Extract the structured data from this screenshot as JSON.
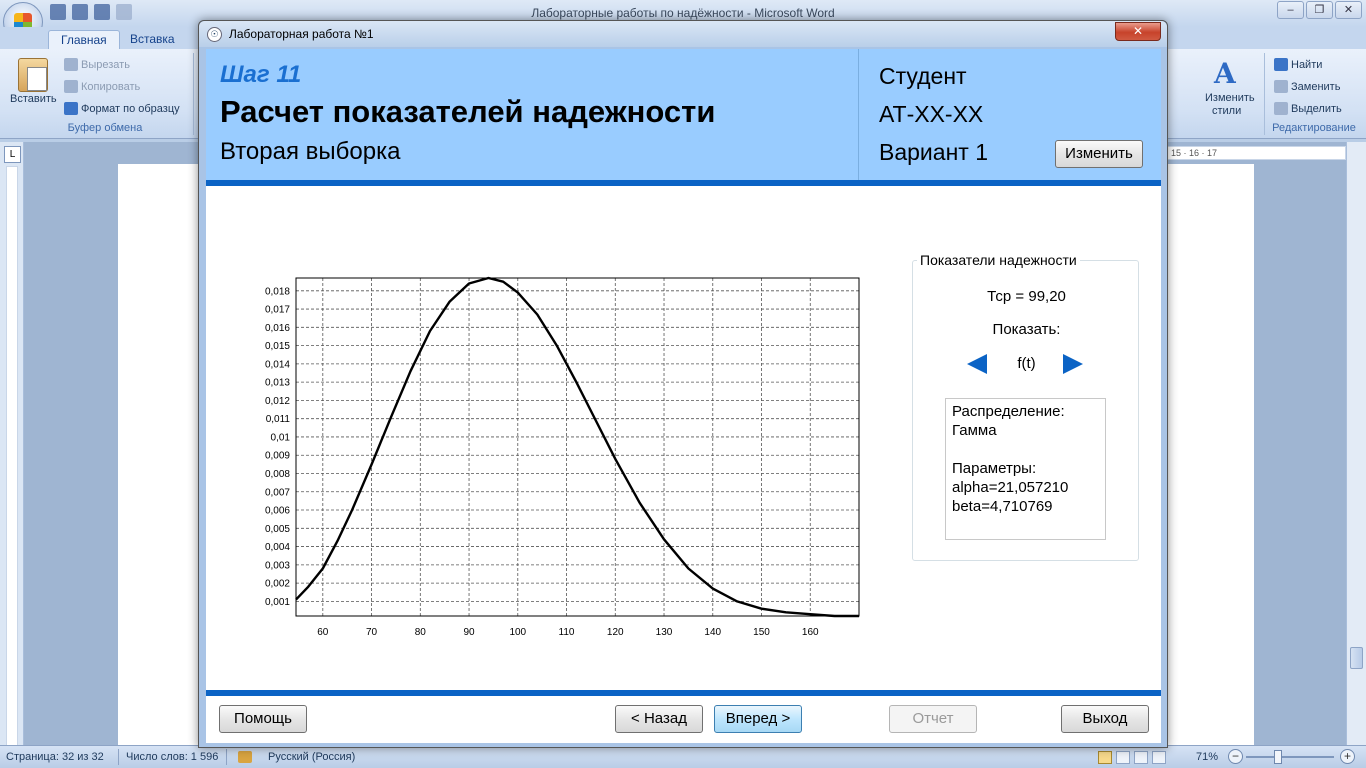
{
  "word": {
    "window_title": "Лабораторные работы по надёжности - Microsoft Word",
    "tabs": [
      "Главная",
      "Вставка"
    ],
    "ribbon": {
      "paste": "Вставить",
      "cut": "Вырезать",
      "copy": "Копировать",
      "format_painter": "Формат по образцу",
      "clipboard_group": "Буфер обмена",
      "change_styles_line1": "Изменить",
      "change_styles_line2": "стили",
      "find": "Найти",
      "replace": "Заменить",
      "select": "Выделить",
      "editing_group": "Редактирование"
    },
    "ruler_right": "15 · 16 · 17",
    "status": {
      "page": "Страница: 32 из 32",
      "words": "Число слов: 1 596",
      "language": "Русский (Россия)",
      "zoom": "71%"
    }
  },
  "dialog": {
    "title": "Лабораторная работа №1",
    "close": "✕",
    "step": "Шаг 11",
    "heading": "Расчет показателей надежности",
    "subheading": "Вторая выборка",
    "student": "Студент",
    "group": "АТ-ХХ-ХХ",
    "variant": "Вариант 1",
    "change_button": "Изменить",
    "panel": {
      "legend": "Показатели надежности",
      "tcp": "Тср = 99,20",
      "show_label": "Показать:",
      "function": "f(t)",
      "distribution_label": "Распределение:",
      "distribution": "Гамма",
      "params_label": "Параметры:",
      "alpha": "alpha=21,057210",
      "beta": "beta=4,710769"
    },
    "buttons": {
      "help": "Помощь",
      "back": "< Назад",
      "next": "Вперед >",
      "report": "Отчет",
      "exit": "Выход"
    }
  },
  "chart_data": {
    "type": "line",
    "title": "",
    "xlabel": "",
    "ylabel": "",
    "xlim": [
      54.5,
      170
    ],
    "ylim": [
      0.0002,
      0.0187
    ],
    "x_ticks": [
      60,
      70,
      80,
      90,
      100,
      110,
      120,
      130,
      140,
      150,
      160
    ],
    "y_ticks": [
      "0,001",
      "0,002",
      "0,003",
      "0,004",
      "0,005",
      "0,006",
      "0,007",
      "0,008",
      "0,009",
      "0,01",
      "0,011",
      "0,012",
      "0,013",
      "0,014",
      "0,015",
      "0,016",
      "0,017",
      "0,018"
    ],
    "y_tick_values": [
      0.001,
      0.002,
      0.003,
      0.004,
      0.005,
      0.006,
      0.007,
      0.008,
      0.009,
      0.01,
      0.011,
      0.012,
      0.013,
      0.014,
      0.015,
      0.016,
      0.017,
      0.018
    ],
    "grid": true,
    "series": [
      {
        "x": [
          54.5,
          57,
          60,
          63,
          66,
          70,
          74,
          78,
          82,
          86,
          90,
          94,
          97,
          100,
          104,
          108,
          112,
          116,
          120,
          125,
          130,
          135,
          140,
          145,
          150,
          155,
          160,
          165,
          170
        ],
        "y": [
          0.0011,
          0.0018,
          0.0028,
          0.0043,
          0.006,
          0.0085,
          0.0111,
          0.0136,
          0.0158,
          0.0174,
          0.0184,
          0.0187,
          0.0185,
          0.0179,
          0.0167,
          0.015,
          0.013,
          0.0109,
          0.0088,
          0.0064,
          0.0044,
          0.0028,
          0.0017,
          0.001,
          0.0006,
          0.0004,
          0.0003,
          0.0002,
          0.0002
        ]
      }
    ]
  }
}
